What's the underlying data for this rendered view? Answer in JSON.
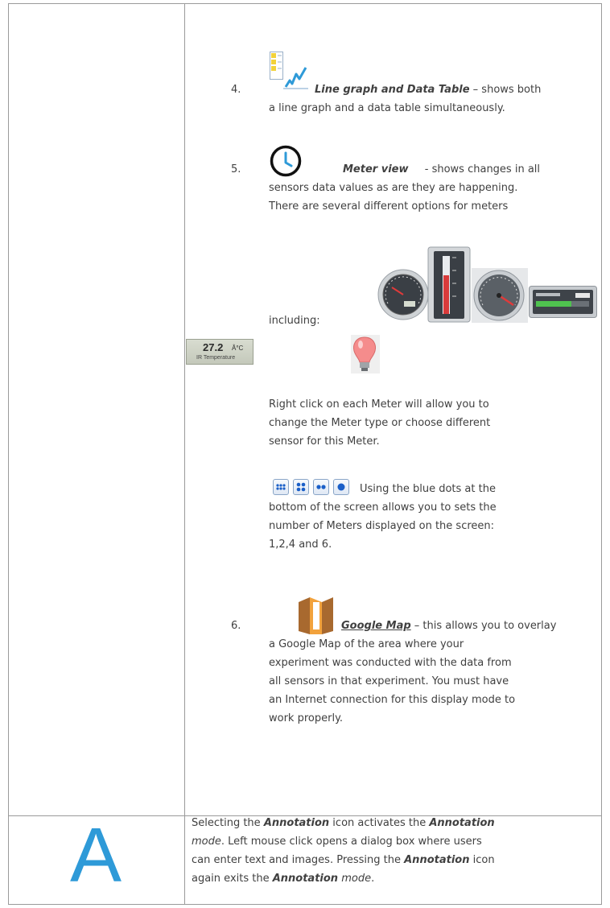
{
  "items": [
    {
      "number": "4.",
      "title": "Line graph and Data Table",
      "text_lines": [
        "– shows both",
        "a line graph and a data table simultaneously."
      ],
      "icon": "line-graph-table-icon"
    },
    {
      "number": "5.",
      "title": "Meter view",
      "text_lines": [
        "- shows changes in all",
        "sensors data values as are they are happening.",
        "There are several different options for meters"
      ],
      "including_label": "including:",
      "icon": "clock-icon",
      "lcd_meter": {
        "value": "27.2",
        "unit": "Â°C",
        "label": "IR Temperature"
      },
      "meter_types": [
        "round-gauge",
        "vertical-thermometer",
        "dial-gauge",
        "digital-bar",
        "lcd-display",
        "light-bulb"
      ],
      "right_click_lines": [
        "Right click on each Meter will allow you to",
        "change the Meter type or choose different",
        "sensor for this Meter."
      ],
      "dots_lines": [
        "Using the blue dots at the",
        "bottom of the screen allows you to sets the",
        "number of Meters displayed on the screen:",
        "1,2,4 and 6."
      ]
    },
    {
      "number": "6.",
      "title": "Google Map",
      "text_lines": [
        "– this allows you to overlay",
        "a Google Map of the area where your",
        "experiment was conducted with the data from",
        "all sensors in that experiment.  You must have",
        "an Internet connection for this display mode to",
        "work properly."
      ],
      "icon": "map-icon"
    }
  ],
  "annotation_row": {
    "icon_letter": "A",
    "lines": [
      [
        {
          "t": "Selecting the ",
          "s": ""
        },
        {
          "t": "Annotation",
          "s": "bi"
        },
        {
          "t": " icon activates the ",
          "s": ""
        },
        {
          "t": "Annotation",
          "s": "bi"
        }
      ],
      [
        {
          "t": "mode",
          "s": "i"
        },
        {
          "t": ". Left mouse click opens a dialog box where users",
          "s": ""
        }
      ],
      [
        {
          "t": "can enter text and images. Pressing the ",
          "s": ""
        },
        {
          "t": "Annotation",
          "s": "bi"
        },
        {
          "t": " icon",
          "s": ""
        }
      ],
      [
        {
          "t": "again exits the ",
          "s": ""
        },
        {
          "t": "Annotation",
          "s": "bi"
        },
        {
          "t": " ",
          "s": ""
        },
        {
          "t": "mode",
          "s": "i"
        },
        {
          "t": ".",
          "s": ""
        }
      ]
    ]
  },
  "colors": {
    "border": "#9a9a9a",
    "text": "#404040",
    "accent_blue": "#2e9ad8",
    "map_brown": "#b5773a",
    "map_orange": "#f2a23c",
    "dot_blue": "#1a5fc8",
    "bulb_pink": "#f58c8c"
  }
}
